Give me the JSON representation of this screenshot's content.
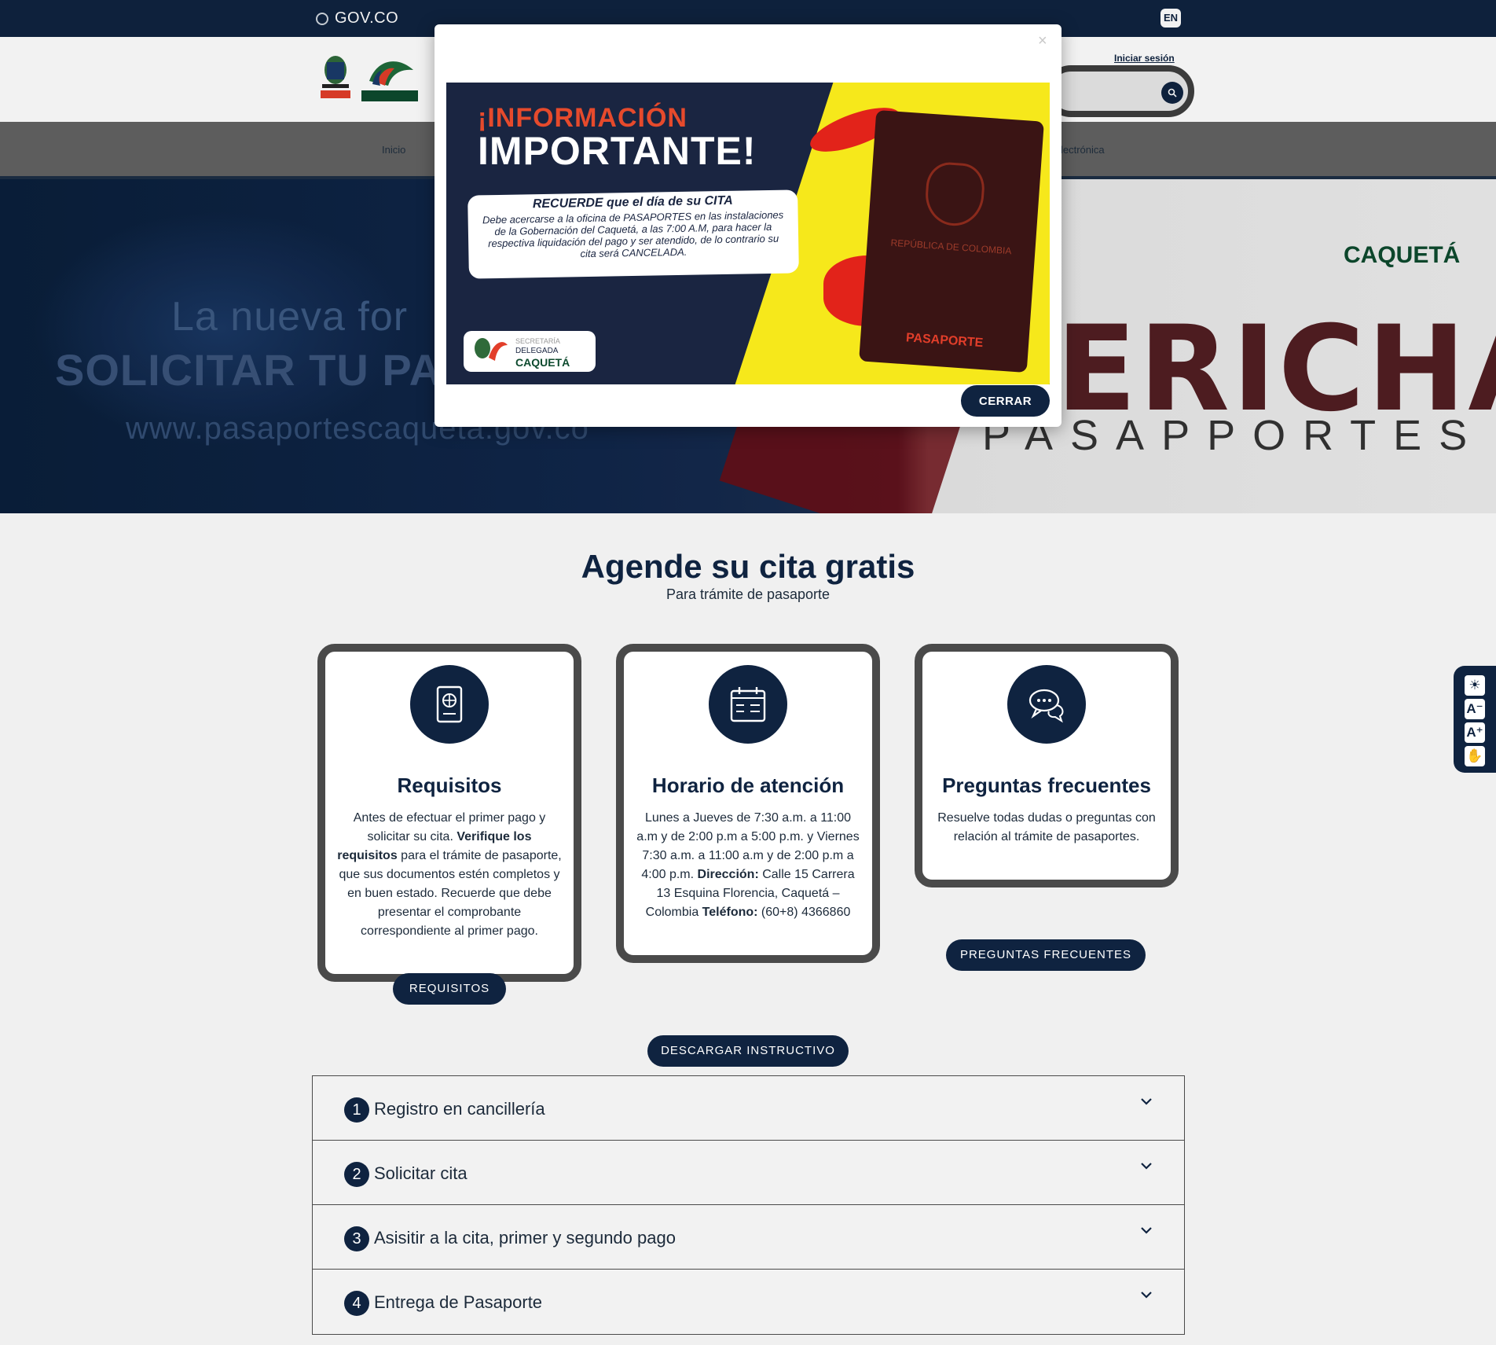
{
  "gov_bar": {
    "brand": "GOV.CO",
    "lang_button": "EN"
  },
  "header": {
    "login_link": "Iniciar sesión",
    "search_placeholder": "",
    "logo_text": "CAQUETÁ"
  },
  "nav": {
    "items": [
      "Inicio",
      "lectrónica"
    ]
  },
  "hero": {
    "line1": "La nueva for",
    "line2": "SOLICITAR TU PA",
    "line3": "www.pasaportescaqueta.gov.co",
    "brand_word": "ERICHÁ",
    "brand_sub": "PASAPPORTES",
    "brand_logo": "CAQUETÁ"
  },
  "modal": {
    "close_symbol": "×",
    "promo": {
      "headline1": "¡INFORMACIÓN",
      "headline2": "IMPORTANTE!",
      "note_title": "RECUERDE que el día de su CITA",
      "note_body": "Debe acercarse a la oficina de PASAPORTES en las instalaciones de la Gobernación del Caquetá, a las 7:00 A.M, para hacer la respectiva liquidación del pago y ser atendido, de lo contrario su cita será CANCELADA.",
      "passport_country": "REPÚBLICA DE COLOMBIA",
      "passport_label": "PASAPORTE",
      "badge_line1": "SECRETARÍA",
      "badge_line2": "DELEGADA",
      "badge_line3": "CAQUETÁ"
    },
    "close_button": "CERRAR"
  },
  "section": {
    "title": "Agende su cita gratis",
    "subtitle": "Para trámite de pasaporte"
  },
  "cards": [
    {
      "icon": "passport-icon",
      "title": "Requisitos",
      "body_pre": "Antes de efectuar el primer pago y solicitar su cita. ",
      "body_bold": "Verifique los requisitos",
      "body_post": " para el trámite de pasaporte, que sus documentos estén completos y en buen estado. Recuerde que debe presentar el comprobante correspondiente al primer pago.",
      "button": "REQUISITOS"
    },
    {
      "icon": "calendar-icon",
      "title": "Horario de atención",
      "body_hours": "Lunes a Jueves de 7:30 a.m. a 11:00 a.m y de 2:00 p.m a 5:00 p.m. y Viernes 7:30 a.m. a 11:00 a.m y de 2:00 p.m a 4:00 p.m.",
      "address_label": "Dirección:",
      "address": " Calle 15 Carrera 13 Esquina Florencia, Caquetá – Colombia ",
      "phone_label": "Teléfono:",
      "phone": " (60+8) 4366860"
    },
    {
      "icon": "chat-icon",
      "title": "Preguntas frecuentes",
      "body": "Resuelve todas dudas o preguntas con relación al trámite de pasaportes.",
      "button": "PREGUNTAS FRECUENTES"
    }
  ],
  "download_button": "DESCARGAR INSTRUCTIVO",
  "accordion": [
    {
      "num": "1",
      "label": "Registro en cancillería"
    },
    {
      "num": "2",
      "label": "Solicitar cita"
    },
    {
      "num": "3",
      "label": "Asisitir a la cita, primer y segundo pago"
    },
    {
      "num": "4",
      "label": "Entrega de Pasaporte"
    }
  ],
  "a11y": {
    "contrast": "☀",
    "decrease": "A⁻",
    "increase": "A⁺",
    "sign": "✋"
  },
  "colors": {
    "navy": "#0f2340",
    "accent_red": "#e64a2c",
    "yellow": "#f6e81b"
  }
}
